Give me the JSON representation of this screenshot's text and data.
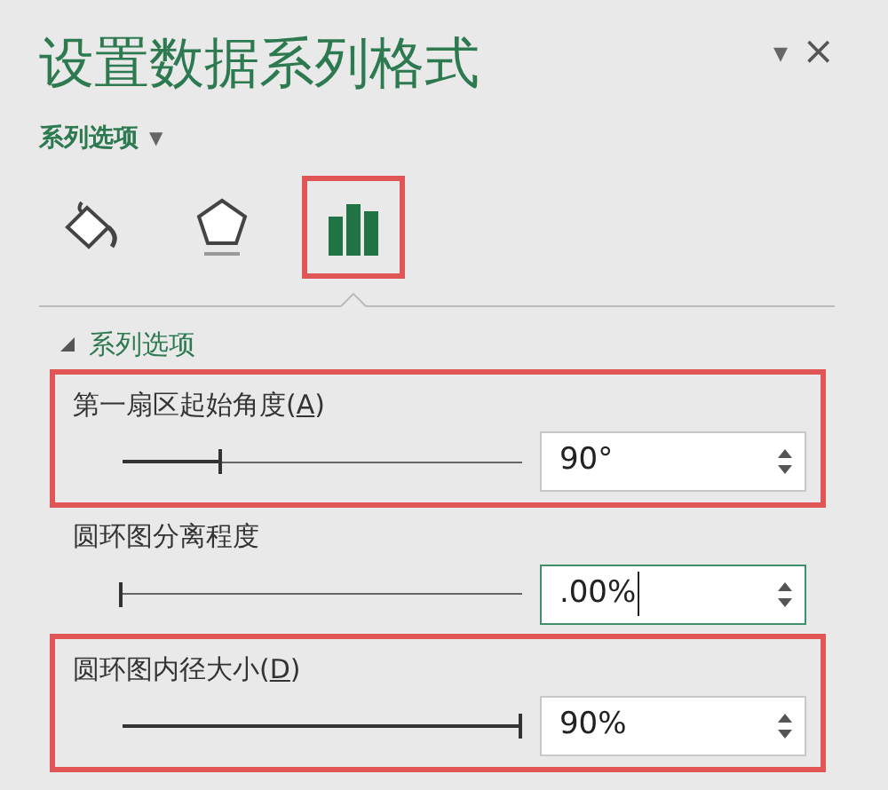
{
  "pane": {
    "title": "设置数据系列格式",
    "menu_glyph": "▾",
    "close_glyph": "×"
  },
  "options_menu": {
    "label": "系列选项",
    "caret": "▼"
  },
  "tabs": [
    {
      "kind": "fill",
      "selected": false,
      "highlighted": false
    },
    {
      "kind": "effects",
      "selected": false,
      "highlighted": false
    },
    {
      "kind": "series",
      "selected": true,
      "highlighted": true
    }
  ],
  "section": {
    "title": "系列选项",
    "expanded": true
  },
  "settings": [
    {
      "label_before": "第一扇区起始角度(",
      "access_key": "A",
      "label_after": ")",
      "level": 0.25,
      "value": "90°",
      "focused": false,
      "highlighted": true
    },
    {
      "label_before": "圆环图分离程度",
      "level": 0,
      "value": ".00%",
      "focused": true,
      "highlighted": false
    },
    {
      "label_before": "圆环图内径大小(",
      "access_key": "D",
      "label_after": ")",
      "level": 1,
      "value": "90%",
      "focused": false,
      "highlighted": true
    }
  ]
}
